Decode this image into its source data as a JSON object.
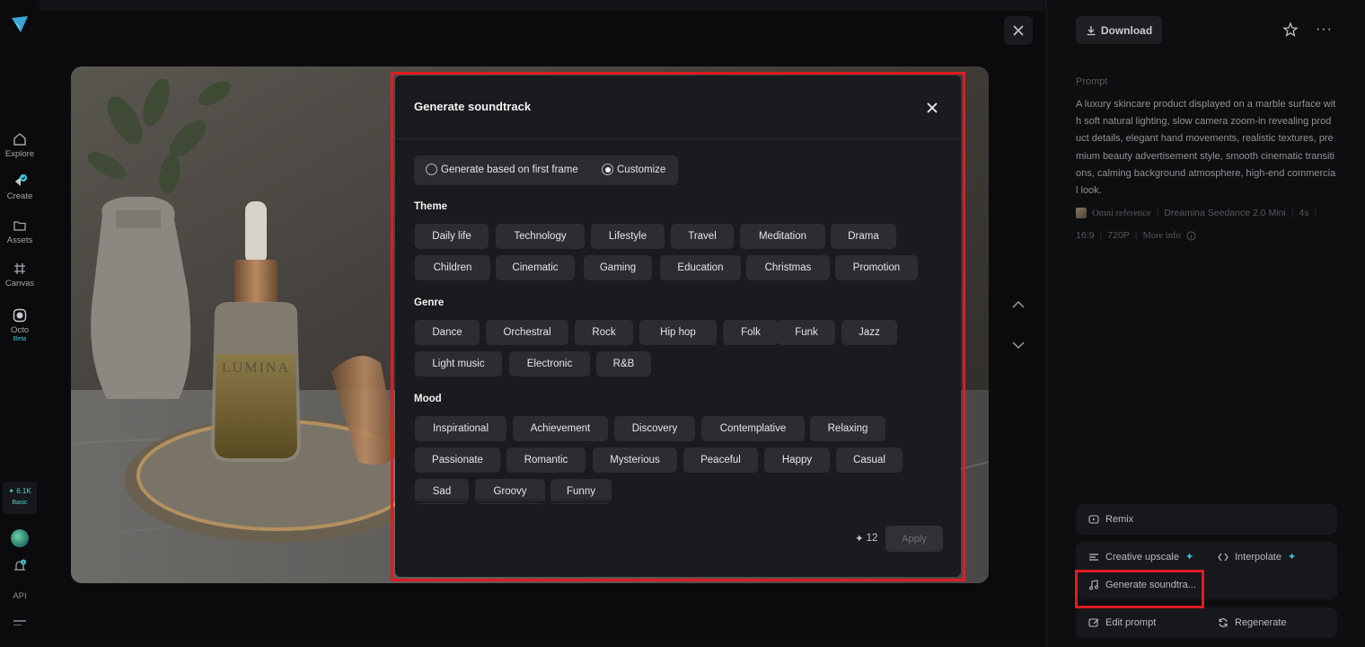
{
  "nav": {
    "items": [
      {
        "label": "Explore",
        "icon": "home-icon"
      },
      {
        "label": "Create",
        "icon": "create-icon"
      },
      {
        "label": "Assets",
        "icon": "folder-icon"
      },
      {
        "label": "Canvas",
        "icon": "canvas-icon"
      },
      {
        "label": "Octo",
        "icon": "octo-icon",
        "badge": "Beta"
      }
    ],
    "credits": {
      "value": "✦ 6.1K",
      "tier": "Basic"
    },
    "notification_count": "1",
    "api_label": "API"
  },
  "viewer": {
    "product_label": "LUMINA"
  },
  "panel": {
    "download_label": "Download",
    "prompt_label": "Prompt",
    "prompt_text": "A luxury skincare product displayed on a marble surface with soft natural lighting, slow camera zoom-in revealing product details, elegant hand movements, realistic textures, premium beauty advertisement style, smooth cinematic transitions, calming background atmosphere, high-end commercial look.",
    "meta_row1": {
      "reference": "Omni reference",
      "model": "Dreamina Seedance 2.0 Mini",
      "duration": "4s"
    },
    "meta_row2": {
      "ratio": "16:9",
      "resolution": "720P",
      "more": "More info"
    },
    "actions": {
      "remix": "Remix",
      "creative_upscale": "Creative upscale",
      "interpolate": "Interpolate",
      "generate_soundtrack": "Generate soundtra...",
      "edit_prompt": "Edit prompt",
      "regenerate": "Regenerate"
    }
  },
  "modal": {
    "title": "Generate soundtrack",
    "mode_options": [
      "Generate based on first frame",
      "Customize"
    ],
    "selected_mode": "Customize",
    "theme_label": "Theme",
    "themes": [
      "Daily life",
      "Technology",
      "Lifestyle",
      "Travel",
      "Meditation",
      "Drama",
      "Children",
      "Cinematic",
      "Gaming",
      "Education",
      "Christmas",
      "Promotion"
    ],
    "genre_label": "Genre",
    "genres": [
      "Dance",
      "Orchestral",
      "Rock",
      "Hip hop",
      "Folk",
      "Funk",
      "Jazz",
      "Light music",
      "Electronic",
      "R&B"
    ],
    "mood_label": "Mood",
    "moods": [
      "Inspirational",
      "Achievement",
      "Discovery",
      "Contemplative",
      "Relaxing",
      "Passionate",
      "Romantic",
      "Mysterious",
      "Peaceful",
      "Happy",
      "Casual",
      "Sad",
      "Groovy",
      "Funny"
    ],
    "cost": "12",
    "apply_label": "Apply"
  }
}
